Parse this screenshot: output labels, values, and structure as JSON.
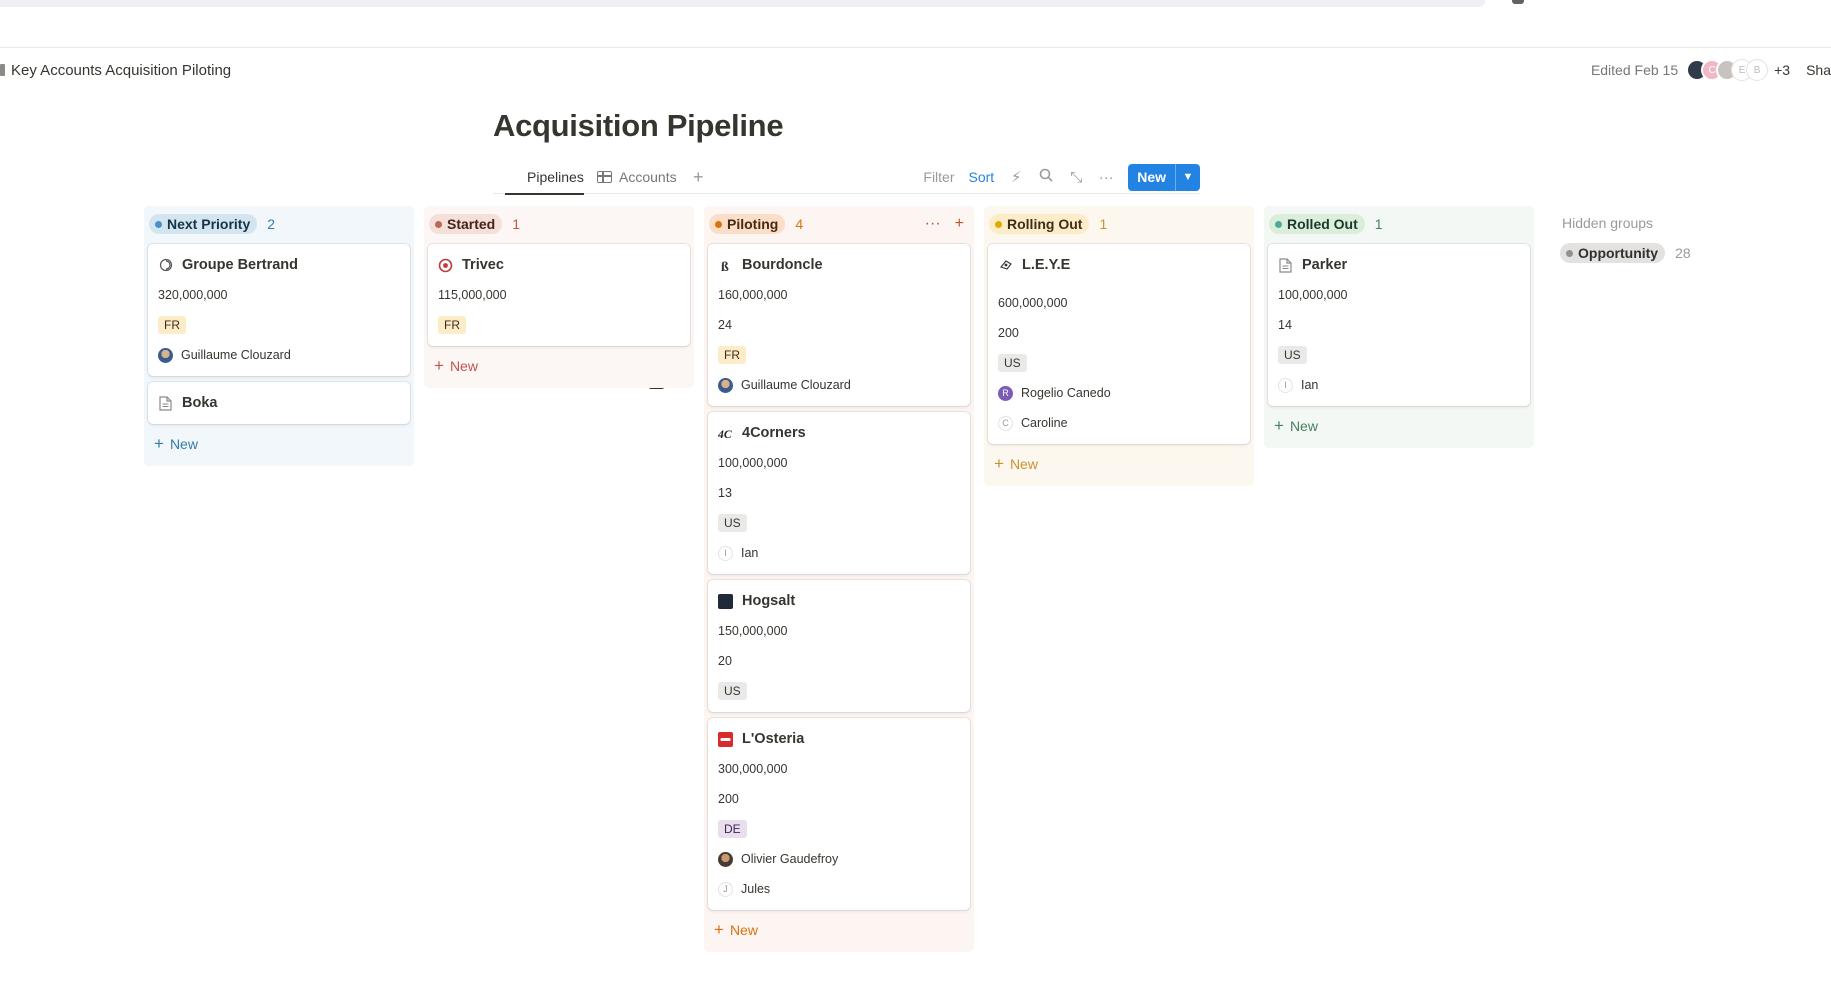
{
  "breadcrumb": {
    "page": "Key Accounts Acquisition Piloting"
  },
  "header": {
    "edited": "Edited Feb 15",
    "avatar_letters": [
      "C",
      "E",
      "B"
    ],
    "more_count": "+3",
    "share": "Sha"
  },
  "title": "Acquisition Pipeline",
  "views": {
    "tabs": [
      "Pipelines",
      "Accounts"
    ],
    "active": "Pipelines",
    "add": "+"
  },
  "toolbar": {
    "filter": "Filter",
    "sort": "Sort",
    "new": "New"
  },
  "columns": [
    {
      "name": "Next Priority",
      "count": "2",
      "color": "#4a8fcf",
      "bg": "#f1f7fb",
      "pill_bg": "#d3e5ef",
      "text": "#183347",
      "accent": "#337ea9",
      "cards": [
        {
          "title": "Groupe Bertrand",
          "icon": "swirl-icon",
          "amount": "320,000,000",
          "tag": "FR",
          "people": [
            "Guillaume Clouzard"
          ]
        },
        {
          "title": "Boka",
          "icon": "page-icon"
        }
      ],
      "new_label": "New"
    },
    {
      "name": "Started",
      "count": "1",
      "color": "#b96a57",
      "bg": "#fcf6f4",
      "pill_bg": "#f4dfd9",
      "text": "#44231b",
      "accent": "#c4554d",
      "cards": [
        {
          "title": "Trivec",
          "icon": "trivec-icon",
          "amount": "115,000,000",
          "tag": "FR"
        }
      ],
      "new_label": "New"
    },
    {
      "name": "Piloting",
      "count": "4",
      "color": "#d9730d",
      "bg": "#fcf5f1",
      "pill_bg": "#fadec9",
      "text": "#49290e",
      "accent": "#d9730d",
      "cards": [
        {
          "title": "Bourdoncle",
          "icon": "b-icon",
          "amount": "160,000,000",
          "number": "24",
          "tag": "FR",
          "people": [
            "Guillaume Clouzard"
          ]
        },
        {
          "title": "4Corners",
          "icon": "4c-icon",
          "amount": "100,000,000",
          "number": "13",
          "tag": "US",
          "people": [
            "Ian"
          ]
        },
        {
          "title": "Hogsalt",
          "icon": "hogsalt-icon",
          "amount": "150,000,000",
          "number": "20",
          "tag": "US"
        },
        {
          "title": "L'Osteria",
          "icon": "losteria-icon",
          "amount": "300,000,000",
          "number": "200",
          "tag": "DE",
          "people": [
            "Olivier Gaudefroy",
            "Jules"
          ]
        }
      ],
      "new_label": "New"
    },
    {
      "name": "Rolling Out",
      "count": "1",
      "color": "#dfab01",
      "bg": "#fcf8ef",
      "pill_bg": "#fdecc8",
      "text": "#402c1b",
      "accent": "#cb912f",
      "cards": [
        {
          "title": "L.E.Y.E",
          "icon": "leye-icon",
          "amount": "600,000,000",
          "number": "200",
          "tag": "US",
          "people": [
            "Rogelio Canedo",
            "Caroline"
          ]
        }
      ],
      "new_label": "New"
    },
    {
      "name": "Rolled Out",
      "count": "1",
      "color": "#4dab9a",
      "bg": "#f4f8f4",
      "pill_bg": "#dbeddb",
      "text": "#1c3829",
      "accent": "#448361",
      "cards": [
        {
          "title": "Parker",
          "icon": "page-icon",
          "amount": "100,000,000",
          "number": "14",
          "tag": "US",
          "people": [
            "Ian"
          ]
        }
      ],
      "new_label": "New"
    }
  ],
  "hidden_groups": {
    "title": "Hidden groups",
    "items": [
      {
        "name": "Opportunity",
        "count": "28"
      }
    ]
  }
}
